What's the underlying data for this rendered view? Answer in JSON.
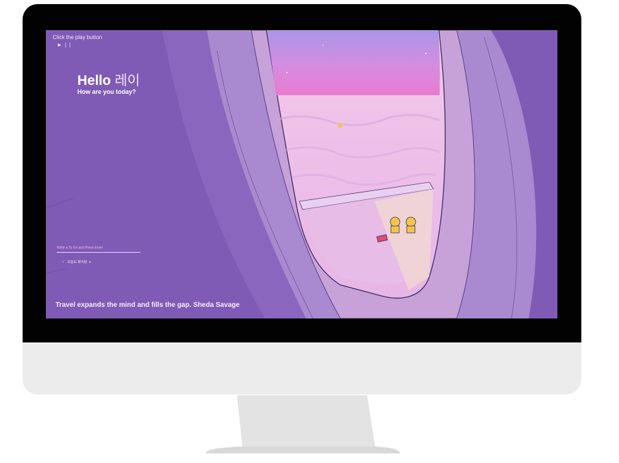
{
  "player": {
    "hint": "Click the play button",
    "play_icon": "play-icon",
    "pause_icon": "pause-icon",
    "play_glyph": "►",
    "pause_glyph": "||"
  },
  "greeting": {
    "hello": "Hello",
    "name": "레이",
    "subtitle": "How are you today?"
  },
  "todo": {
    "placeholder": "Write a To Do and Press Enter",
    "items": [
      {
        "text": "오늘도 화이팅",
        "delete_label": "x"
      }
    ]
  },
  "quote": {
    "text": "Travel expands the mind and fills the gap. Sheda Savage"
  },
  "colors": {
    "screen_bg": "#7f5bb5",
    "window_frame": "#a989cf",
    "window_frame_inner": "#c6a2d8",
    "sky_top": "#a996e8",
    "sky_pink": "#ea7bd0",
    "clouds": "#f0bce6",
    "bezel": "#020202",
    "chin": "#ececec"
  }
}
